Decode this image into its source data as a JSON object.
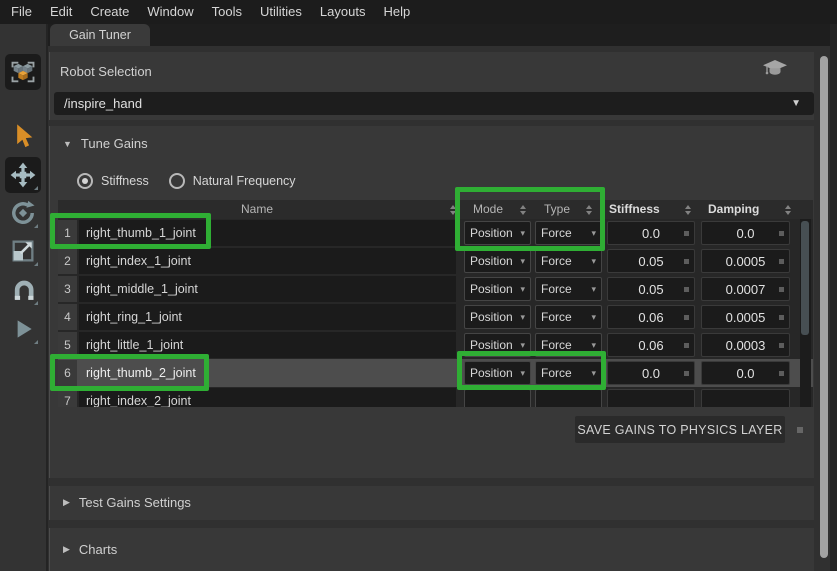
{
  "menu": {
    "items": [
      "File",
      "Edit",
      "Create",
      "Window",
      "Tools",
      "Utilities",
      "Layouts",
      "Help"
    ]
  },
  "tabs": {
    "gain_tuner": "Gain Tuner"
  },
  "icons": {
    "collapse_open": "▼",
    "collapse_closed": "▶",
    "dropdown_arrow": "▼",
    "cell_dropdown_arrow": "▾"
  },
  "robot_selection": {
    "title": "Robot Selection",
    "selected_robot": "/inspire_hand"
  },
  "tune_gains": {
    "title": "Tune Gains",
    "radios": {
      "stiffness": "Stiffness",
      "natural_frequency": "Natural Frequency"
    },
    "table": {
      "headers": {
        "name": "Name",
        "mode": "Mode",
        "type": "Type",
        "stiffness": "Stiffness",
        "damping": "Damping"
      },
      "rows": [
        {
          "num": "1",
          "name": "right_thumb_1_joint",
          "mode": "Position",
          "type": "Force",
          "stiffness": "0.0",
          "damping": "0.0"
        },
        {
          "num": "2",
          "name": "right_index_1_joint",
          "mode": "Position",
          "type": "Force",
          "stiffness": "0.05",
          "damping": "0.0005"
        },
        {
          "num": "3",
          "name": "right_middle_1_joint",
          "mode": "Position",
          "type": "Force",
          "stiffness": "0.05",
          "damping": "0.0007"
        },
        {
          "num": "4",
          "name": "right_ring_1_joint",
          "mode": "Position",
          "type": "Force",
          "stiffness": "0.06",
          "damping": "0.0005"
        },
        {
          "num": "5",
          "name": "right_little_1_joint",
          "mode": "Position",
          "type": "Force",
          "stiffness": "0.06",
          "damping": "0.0003"
        },
        {
          "num": "6",
          "name": "right_thumb_2_joint",
          "mode": "Position",
          "type": "Force",
          "stiffness": "0.0",
          "damping": "0.0"
        },
        {
          "num": "7",
          "name": "right_index_2_joint",
          "mode": "",
          "type": "",
          "stiffness": "",
          "damping": ""
        }
      ]
    },
    "save_button": "SAVE GAINS TO PHYSICS LAYER"
  },
  "test_gains": {
    "title": "Test Gains Settings"
  },
  "charts": {
    "title": "Charts"
  },
  "colors": {
    "annotation_green": "#2fae34",
    "accent_orange": "#d98e27"
  }
}
